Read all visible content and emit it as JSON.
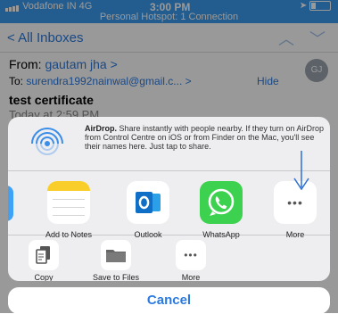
{
  "status_bar": {
    "carrier": "Vodafone IN  4G",
    "time": "3:00 PM",
    "hotspot": "Personal Hotspot: 1 Connection"
  },
  "mail": {
    "back_label": "All Inboxes",
    "from_prefix": "From: ",
    "from_name": "gautam jha",
    "to_prefix": "To: ",
    "to_address": "surendra1992nainwal@gmail.c...",
    "hide_label": "Hide",
    "avatar_initials": "GJ",
    "subject": "test certificate",
    "date": "Today at 2:59 PM"
  },
  "share_sheet": {
    "airdrop_title": "AirDrop.",
    "airdrop_text": " Share instantly with people nearby. If they turn on AirDrop from Control Centre on iOS or from Finder on the Mac, you'll see their names here. Just tap to share.",
    "apps": [
      {
        "label": "Add to Notes",
        "icon": "notes-icon"
      },
      {
        "label": "Outlook",
        "icon": "outlook-icon"
      },
      {
        "label": "WhatsApp",
        "icon": "whatsapp-icon"
      },
      {
        "label": "More",
        "icon": "more-icon"
      }
    ],
    "actions": [
      {
        "label": "Copy",
        "icon": "copy-icon"
      },
      {
        "label": "Save to Files",
        "icon": "folder-icon"
      },
      {
        "label": "More",
        "icon": "more-icon"
      }
    ],
    "cancel_label": "Cancel"
  },
  "colors": {
    "status_bar": "#3b9cf1",
    "accent": "#2a7ae2",
    "whatsapp_green": "#3cd14e",
    "notes_yellow": "#f9ce2b",
    "outlook_blue": "#0f6fc6"
  }
}
